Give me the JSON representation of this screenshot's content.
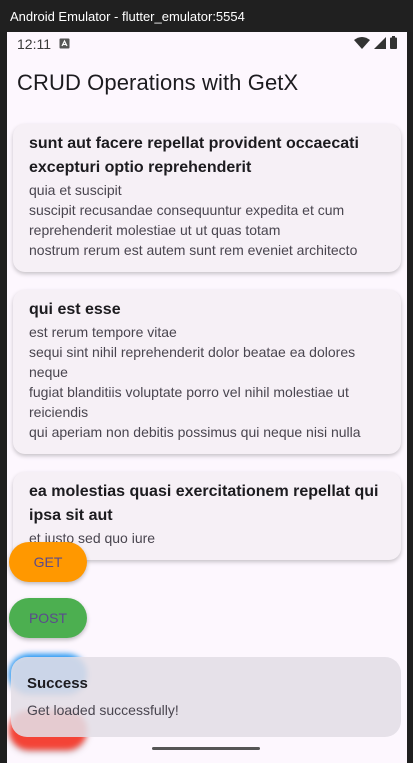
{
  "window": {
    "title": "Android Emulator - flutter_emulator:5554"
  },
  "status_bar": {
    "time": "12:11",
    "icons": [
      "notification-a-icon",
      "wifi-icon",
      "signal-icon",
      "battery-icon"
    ]
  },
  "app_bar": {
    "title": "CRUD Operations with GetX"
  },
  "posts": [
    {
      "title": "sunt aut facere repellat provident occaecati excepturi optio reprehenderit",
      "body": "quia et suscipit\nsuscipit recusandae consequuntur expedita et cum reprehenderit molestiae ut ut quas totam\nnostrum rerum est autem sunt rem eveniet architecto"
    },
    {
      "title": "qui est esse",
      "body": "est rerum tempore vitae\nsequi sint nihil reprehenderit dolor beatae ea dolores neque\nfugiat blanditiis voluptate porro vel nihil molestiae ut reiciendis\nqui aperiam non debitis possimus qui neque nisi nulla"
    },
    {
      "title": "ea molestias quasi exercitationem repellat qui ipsa sit aut",
      "body": "et iusto sed quo iure"
    }
  ],
  "buttons": {
    "get": "GET",
    "post": "POST"
  },
  "snackbar": {
    "title": "Success",
    "message": "Get loaded successfully!"
  },
  "colors": {
    "get": "#ff9800",
    "post": "#4caf50",
    "put": "#2196f3",
    "delete": "#f44336"
  }
}
